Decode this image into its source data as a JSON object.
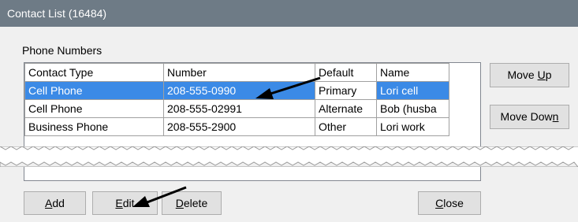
{
  "window": {
    "title": "Contact List (16484)"
  },
  "phone_group": {
    "label": "Phone Numbers"
  },
  "table": {
    "columns": [
      "Contact Type",
      "Number",
      "Default",
      "Name"
    ],
    "rows": [
      {
        "type": "Cell Phone",
        "number": "208-555-0990",
        "default": "Primary",
        "name": "Lori cell",
        "selected": true
      },
      {
        "type": "Cell Phone",
        "number": "208-555-02991",
        "default": "Alternate",
        "name": "Bob (husba",
        "selected": false
      },
      {
        "type": "Business Phone",
        "number": "208-555-2900",
        "default": "Other",
        "name": "Lori work",
        "selected": false
      }
    ]
  },
  "buttons": {
    "move_up": {
      "pre": "Move ",
      "key": "U",
      "post": "p"
    },
    "move_down": {
      "pre": "Move Dow",
      "key": "n",
      "post": ""
    },
    "add": {
      "pre": "",
      "key": "A",
      "post": "dd"
    },
    "edit": {
      "pre": "",
      "key": "E",
      "post": "dit"
    },
    "delete": {
      "pre": "",
      "key": "D",
      "post": "elete"
    },
    "close": {
      "pre": "",
      "key": "C",
      "post": "lose"
    }
  },
  "colors": {
    "titlebar": "#6e7b86",
    "selection": "#3b8ae6",
    "annotation_arrow": "#000000"
  }
}
